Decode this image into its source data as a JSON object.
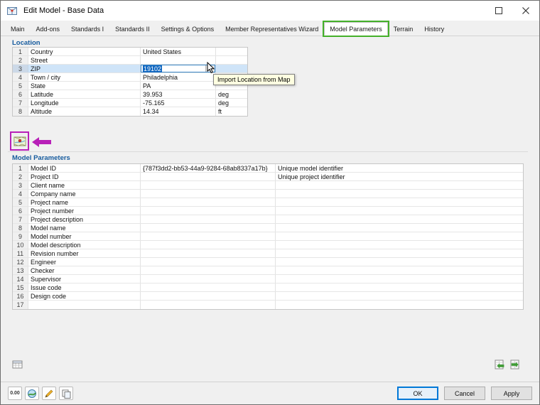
{
  "window": {
    "title": "Edit Model - Base Data"
  },
  "tabs": {
    "items": [
      {
        "label": "Main",
        "active": false
      },
      {
        "label": "Add-ons",
        "active": false
      },
      {
        "label": "Standards I",
        "active": false
      },
      {
        "label": "Standards II",
        "active": false
      },
      {
        "label": "Settings & Options",
        "active": false
      },
      {
        "label": "Member Representatives Wizard",
        "active": false
      },
      {
        "label": "Model Parameters",
        "active": true
      },
      {
        "label": "Terrain",
        "active": false
      },
      {
        "label": "History",
        "active": false
      }
    ]
  },
  "location": {
    "header": "Location",
    "tooltip": "Import Location from Map",
    "rows": [
      {
        "num": "1",
        "label": "Country",
        "value": "United States",
        "unit": ""
      },
      {
        "num": "2",
        "label": "Street",
        "value": "",
        "unit": ""
      },
      {
        "num": "3",
        "label": "ZIP",
        "value": "19102",
        "unit": "",
        "selected": true,
        "editing": true
      },
      {
        "num": "4",
        "label": "Town / city",
        "value": "Philadelphia",
        "unit": ""
      },
      {
        "num": "5",
        "label": "State",
        "value": "PA",
        "unit": ""
      },
      {
        "num": "6",
        "label": "Latitude",
        "value": "39.953",
        "unit": "deg"
      },
      {
        "num": "7",
        "label": "Longitude",
        "value": "-75.165",
        "unit": "deg"
      },
      {
        "num": "8",
        "label": "Altitude",
        "value": "14.34",
        "unit": "ft"
      }
    ]
  },
  "model_parameters": {
    "header": "Model Parameters",
    "rows": [
      {
        "num": "1",
        "label": "Model ID",
        "value": "{787f3dd2-bb53-44a9-9284-68ab8337a17b}",
        "comment": "Unique model identifier"
      },
      {
        "num": "2",
        "label": "Project ID",
        "value": "",
        "comment": "Unique project identifier"
      },
      {
        "num": "3",
        "label": "Client name",
        "value": "",
        "comment": ""
      },
      {
        "num": "4",
        "label": "Company name",
        "value": "",
        "comment": ""
      },
      {
        "num": "5",
        "label": "Project name",
        "value": "",
        "comment": ""
      },
      {
        "num": "6",
        "label": "Project number",
        "value": "",
        "comment": ""
      },
      {
        "num": "7",
        "label": "Project description",
        "value": "",
        "comment": ""
      },
      {
        "num": "8",
        "label": "Model name",
        "value": "",
        "comment": ""
      },
      {
        "num": "9",
        "label": "Model number",
        "value": "",
        "comment": ""
      },
      {
        "num": "10",
        "label": "Model description",
        "value": "",
        "comment": ""
      },
      {
        "num": "11",
        "label": "Revision number",
        "value": "",
        "comment": ""
      },
      {
        "num": "12",
        "label": "Engineer",
        "value": "",
        "comment": ""
      },
      {
        "num": "13",
        "label": "Checker",
        "value": "",
        "comment": ""
      },
      {
        "num": "14",
        "label": "Supervisor",
        "value": "",
        "comment": ""
      },
      {
        "num": "15",
        "label": "Issue code",
        "value": "",
        "comment": ""
      },
      {
        "num": "16",
        "label": "Design code",
        "value": "",
        "comment": ""
      },
      {
        "num": "17",
        "label": "",
        "value": "",
        "comment": ""
      }
    ]
  },
  "footer": {
    "units_label": "0.00",
    "ok_label": "OK",
    "cancel_label": "Cancel",
    "apply_label": "Apply"
  },
  "colors": {
    "tab_highlight": "#44b02a",
    "annotation_marker": "#b820b8",
    "selection_row": "#cfe4f8",
    "text_selection": "#0f66c0",
    "accent": "#0078d7",
    "section_header": "#155a9d"
  }
}
